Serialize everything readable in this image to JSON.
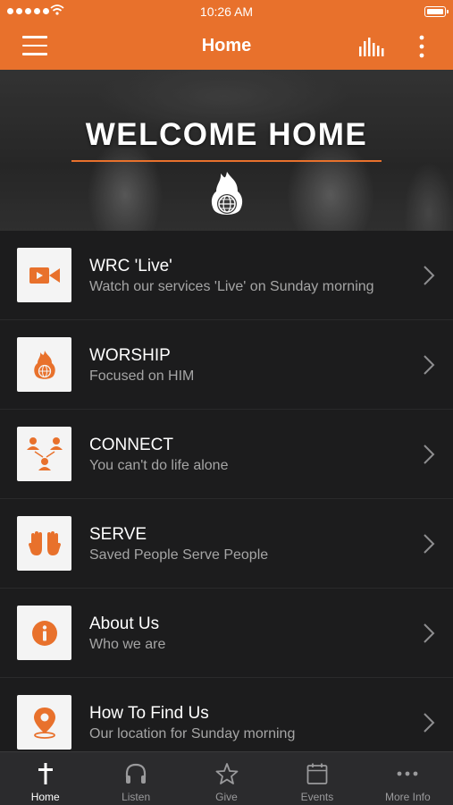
{
  "status_bar": {
    "time": "10:26 AM"
  },
  "nav": {
    "title": "Home",
    "menu_icon": "hamburger-menu-icon",
    "audio_icon": "audio-bars-icon",
    "more_icon": "more-vertical-icon"
  },
  "hero": {
    "heading": "WELCOME HOME",
    "logo_icon": "flame-globe-logo"
  },
  "menu_items": [
    {
      "title": "WRC 'Live'",
      "subtitle": "Watch our services 'Live' on Sunday morning",
      "icon": "video-camera-icon"
    },
    {
      "title": "WORSHIP",
      "subtitle": "Focused on HIM",
      "icon": "flame-globe-icon"
    },
    {
      "title": "CONNECT",
      "subtitle": "You can't do life alone",
      "icon": "people-network-icon"
    },
    {
      "title": "SERVE",
      "subtitle": "Saved People Serve People",
      "icon": "raised-hands-icon"
    },
    {
      "title": "About Us",
      "subtitle": "Who we are",
      "icon": "info-icon"
    },
    {
      "title": "How To Find Us",
      "subtitle": "Our location for Sunday morning",
      "icon": "map-pin-icon"
    }
  ],
  "tab_bar": [
    {
      "label": "Home",
      "icon": "cross-icon",
      "active": true
    },
    {
      "label": "Listen",
      "icon": "headphones-icon",
      "active": false
    },
    {
      "label": "Give",
      "icon": "star-icon",
      "active": false
    },
    {
      "label": "Events",
      "icon": "calendar-icon",
      "active": false
    },
    {
      "label": "More Info",
      "icon": "more-horizontal-icon",
      "active": false
    }
  ],
  "colors": {
    "accent": "#e8712c",
    "background": "#1c1c1d",
    "tab_bar": "#2b2b2d",
    "tile": "#f4f4f4"
  }
}
